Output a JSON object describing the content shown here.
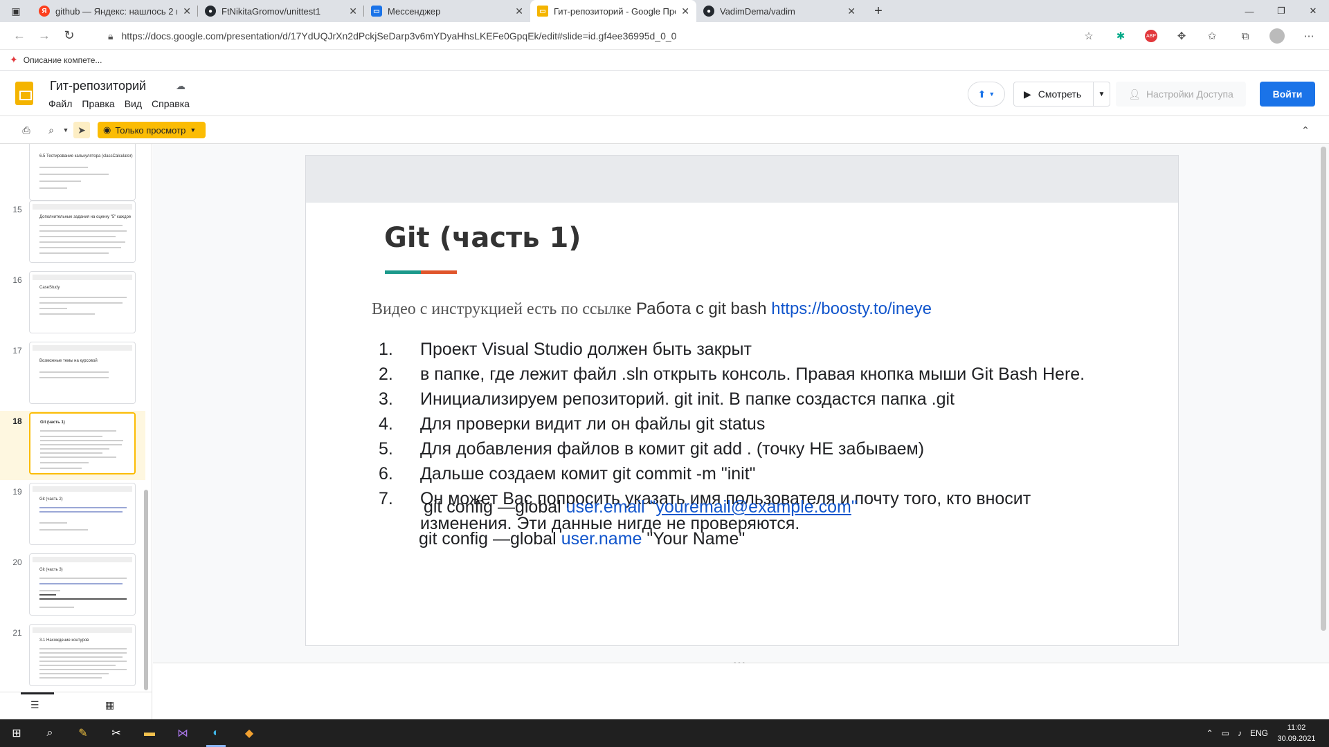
{
  "browser": {
    "tabs": [
      {
        "title": "github — Яндекс: нашлось 2 млн",
        "favicon": "Я",
        "color": "#fc3f1d"
      },
      {
        "title": "FtNikitaGromov/unittest1",
        "favicon": "github",
        "color": "#24292f"
      },
      {
        "title": "Мессенджер",
        "favicon": "chat",
        "color": "#1a73e8"
      },
      {
        "title": "Гит-репозиторий - Google Презентации",
        "favicon": "slides",
        "color": "#f4b400"
      },
      {
        "title": "VadimDema/vadim",
        "favicon": "github",
        "color": "#24292f"
      }
    ],
    "url": "https://docs.google.com/presentation/d/17YdUQJrXn2dPckjSeDarp3v6mYDyaHhsLKEFe0GpqEk/edit#slide=id.gf4ee36995d_0_0",
    "bookmark": "Описание компете..."
  },
  "app": {
    "doc_title": "Гит-репозиторий",
    "menus": [
      "Файл",
      "Правка",
      "Вид",
      "Справка"
    ],
    "view_button": "Смотреть",
    "access_button": "Настройки Доступа",
    "login_button": "Войти",
    "view_only": "Только просмотр"
  },
  "filmstrip": [
    {
      "num": "",
      "title": "6.5 Тестирование калькулятора (classCalculator)"
    },
    {
      "num": "15",
      "title": "Дополнительные задания на оценку \"5\" каждое"
    },
    {
      "num": "16",
      "title": "CaseStudy"
    },
    {
      "num": "17",
      "title": "Возможные темы на курсовой"
    },
    {
      "num": "18",
      "title": "Git (часть 1)"
    },
    {
      "num": "19",
      "title": "Git (часть 2)"
    },
    {
      "num": "20",
      "title": "Git (часть 3)"
    },
    {
      "num": "21",
      "title": "3.1 Нахождение контуров"
    }
  ],
  "slide": {
    "title": "Git (часть 1)",
    "intro_serif": "Видео с инструкцией есть по ссылке",
    "intro_text": "Работа с git bash",
    "intro_link": "https://boosty.to/ineye",
    "steps": [
      {
        "n": "1.",
        "text": "Проект Visual Studio должен быть закрыт"
      },
      {
        "n": "2.",
        "text": "в папке, где лежит файл .sln открыть консоль. Правая кнопка мыши Git Bash Here."
      },
      {
        "n": "3.",
        "text": "Инициализируем репозиторий. git init. В папке создастся папка .git"
      },
      {
        "n": "4.",
        "text": "Для проверки видит ли он файлы git status"
      },
      {
        "n": "5.",
        "text": "Для добавления файлов в  комит git add . (точку НЕ забываем)"
      },
      {
        "n": "6.",
        "text": "Дальше создаем комит git commit -m \"init\""
      },
      {
        "n": "7.",
        "text": "Он может Вас попросить указать имя пользователя и почту того, кто вносит изменения. Эти данные нигде не проверяются."
      }
    ],
    "cfg_email_prefix": " git config —global ",
    "cfg_email_key": "user.email",
    "cfg_email_q1": " \"",
    "cfg_email_value": "youremail@example.com",
    "cfg_email_q2": "\"",
    "cfg_name_prefix": "git config —global ",
    "cfg_name_key": "user.name",
    "cfg_name_value": " \"Your Name\""
  },
  "taskbar": {
    "lang": "ENG",
    "time": "11:02",
    "date": "30.09.2021"
  },
  "colors": {
    "accent_teal": "#1b998b",
    "accent_orange": "#e0552b",
    "brand_yellow": "#fbbc04",
    "link": "#1155cc"
  }
}
